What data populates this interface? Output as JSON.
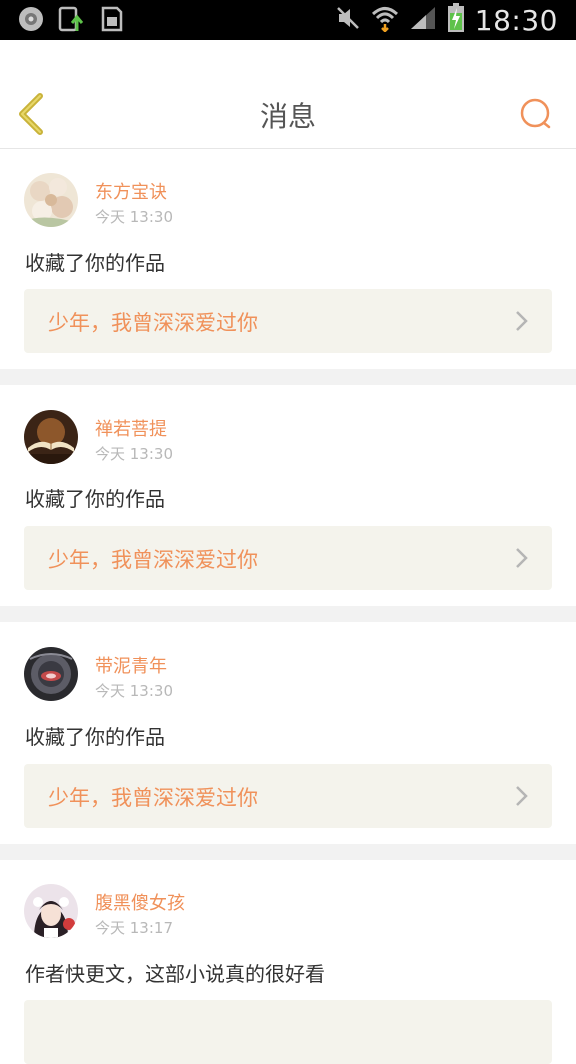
{
  "status_bar": {
    "time": "18:30",
    "icons": [
      "gallery-notification-icon",
      "upload-notification-icon",
      "sd-card-icon",
      "mute-icon",
      "wifi-icon",
      "signal-icon",
      "battery-charging-icon"
    ]
  },
  "header": {
    "title": "消息",
    "back_icon": "chevron-left-icon",
    "search_icon": "search-icon"
  },
  "colors": {
    "accent": "#f0915a",
    "back": "#c9b33a",
    "card_link_bg": "#f4f3ec",
    "divider": "#f2f2f2"
  },
  "messages": [
    {
      "user": "东方宝诀",
      "time": "今天 13:30",
      "text": "收藏了你的作品",
      "work": "少年，我曾深深爱过你",
      "avatar": "flowers-avatar"
    },
    {
      "user": "禅若菩提",
      "time": "今天 13:30",
      "text": "收藏了你的作品",
      "work": "少年，我曾深深爱过你",
      "avatar": "book-avatar"
    },
    {
      "user": "带泥青年",
      "time": "今天 13:30",
      "text": "收藏了你的作品",
      "work": "少年，我曾深深爱过你",
      "avatar": "eye-avatar"
    },
    {
      "user": "腹黑傻女孩",
      "time": "今天 13:17",
      "text": "作者快更文，这部小说真的很好看",
      "work": "",
      "avatar": "girl-avatar"
    }
  ]
}
